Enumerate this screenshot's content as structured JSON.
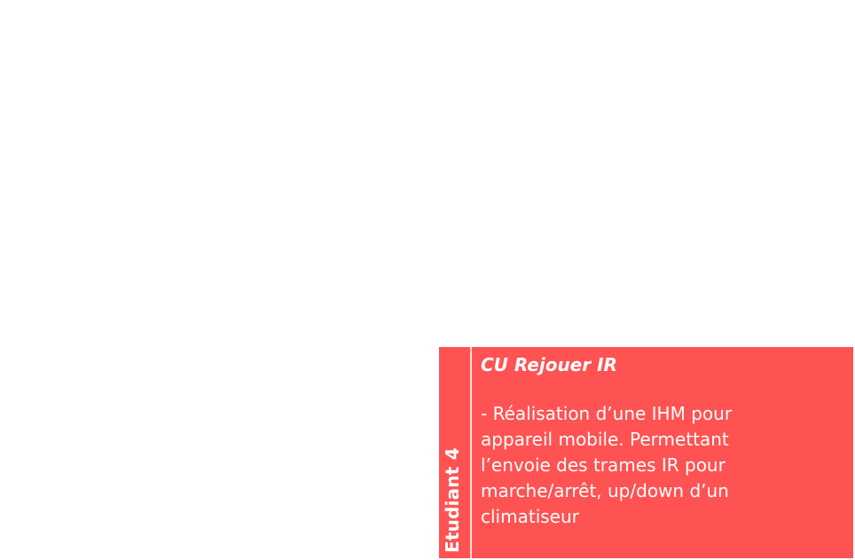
{
  "card": {
    "side_label": "Etudiant 4",
    "title": "CU Rejouer IR",
    "description": "- Réalisation d’une IHM pour\nappareil mobile. Permettant\nl’envoie des trames IR pour\nmarche/arrêt, up/down d’un\nclimatiseur"
  },
  "colors": {
    "card_background": "#ff5252",
    "text": "#ffffff"
  }
}
